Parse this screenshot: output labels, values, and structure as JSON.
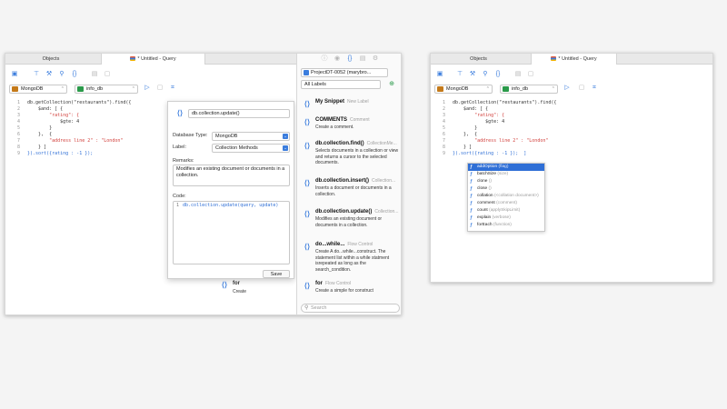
{
  "left": {
    "tabs": {
      "objects": "Objects",
      "query": "* Untitled - Query"
    },
    "connection": "MongoDB",
    "database": "info_db",
    "code_lines": [
      {
        "n": "1",
        "text": "db.getCollection(\"restaurants\").find({"
      },
      {
        "n": "2",
        "text": "    $and: [ {"
      },
      {
        "n": "3",
        "text": "        \"rating\": {"
      },
      {
        "n": "4",
        "text": "            $gte: 4"
      },
      {
        "n": "5",
        "text": "        }"
      },
      {
        "n": "6",
        "text": "    },  {"
      },
      {
        "n": "7",
        "text": "        \"address line 2\" : \"London\""
      },
      {
        "n": "8",
        "text": "    } ]"
      },
      {
        "n": "9",
        "text": "}).sort({rating : -1 });"
      }
    ],
    "snippet_editor": {
      "name_value": "db.collection.update()",
      "db_type_label": "Database Type:",
      "db_type_value": "MongoDB",
      "label_label": "Label:",
      "label_value": "Collection Methods",
      "remarks_label": "Remarks:",
      "remarks_value": "Modifies an existing document or documents in a collection.",
      "code_label": "Code:",
      "code_line_no": "1",
      "code_value": "db.collection.update(query, update)",
      "save_label": "Save"
    },
    "drag_item": {
      "title": "for",
      "desc": "Create"
    }
  },
  "panel": {
    "project": "ProjectDT-0052 (marybro...",
    "filter": "All Labels",
    "search_placeholder": "Search",
    "snippets": [
      {
        "title": "My Snippet",
        "tag": "New Label",
        "desc": ""
      },
      {
        "title": "COMMENTS",
        "tag": "Comment",
        "desc": "Create a comment."
      },
      {
        "title": "db.collection.find()",
        "tag": "CollectionMe...",
        "desc": "Selects documents in a collection or view and returns a cursor to the selected documents."
      },
      {
        "title": "db.collection.insert()",
        "tag": "Collection...",
        "desc": "Inserts a document or documents in a collection."
      },
      {
        "title": "db.collection.update()",
        "tag": "Collection...",
        "desc": "Modifies an existing document or documents in a collection."
      },
      {
        "title": "do...while...",
        "tag": "Flow Control",
        "desc": "Create A do...while...construct. The statement list within a while statment isrepeated as long as the search_condition."
      },
      {
        "title": "for",
        "tag": "Flow Control",
        "desc": "Create a simple for construct"
      }
    ]
  },
  "right": {
    "tabs": {
      "objects": "Objects",
      "query": "* Untitled - Query"
    },
    "connection": "MongoDB",
    "database": "info_db",
    "code_lines": [
      {
        "n": "1",
        "text": "db.getCollection(\"restaurants\").find({"
      },
      {
        "n": "2",
        "text": "    $and: [ {"
      },
      {
        "n": "3",
        "text": "        \"rating\": {"
      },
      {
        "n": "4",
        "text": "            $gte: 4"
      },
      {
        "n": "5",
        "text": "        }"
      },
      {
        "n": "6",
        "text": "    },  {"
      },
      {
        "n": "7",
        "text": "        \"address line 2\" : \"London\""
      },
      {
        "n": "8",
        "text": "    } ]"
      },
      {
        "n": "9",
        "text": "}).sort({rating : -1 });  ]"
      }
    ],
    "autocomplete": [
      {
        "name": "addOption",
        "hint": "(flag)"
      },
      {
        "name": "batchSize",
        "hint": "(size)"
      },
      {
        "name": "clone",
        "hint": "()"
      },
      {
        "name": "close",
        "hint": "()"
      },
      {
        "name": "collation",
        "hint": "(<collation document>)"
      },
      {
        "name": "comment",
        "hint": "(comment)"
      },
      {
        "name": "count",
        "hint": "(applySkipLimit)"
      },
      {
        "name": "explain",
        "hint": "(verbose)"
      },
      {
        "name": "forEach",
        "hint": "(function)"
      }
    ]
  },
  "colors": {
    "accent": "#2f6fd6",
    "string": "#d2413d",
    "number": "#2a8a54"
  }
}
